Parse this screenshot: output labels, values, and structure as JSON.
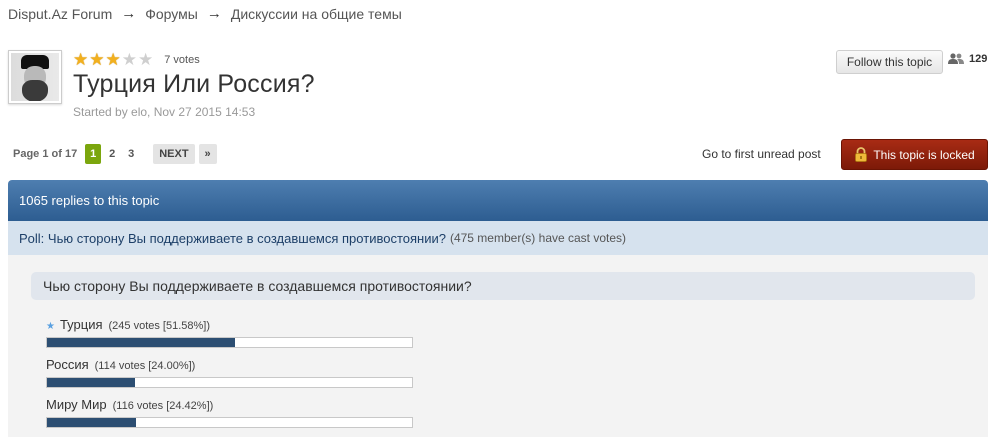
{
  "breadcrumb": {
    "items": [
      "Disput.Az Forum",
      "Форумы",
      "Дискуссии на общие темы"
    ],
    "separator": "→"
  },
  "topic": {
    "title": "Турция Или Россия?",
    "started": "Started by elo, Nov 27 2015 14:53",
    "rating": {
      "stars_on": 3,
      "stars_total": 5,
      "votes_label": "7 votes"
    },
    "follow_label": "Follow this topic",
    "followers_count": "129",
    "avatar_alt": "user avatar"
  },
  "pagination": {
    "label": "Page 1 of 17",
    "pages": [
      "1",
      "2",
      "3"
    ],
    "current": "1",
    "next_label": "NEXT",
    "last_label": "»"
  },
  "actions": {
    "first_unread": "Go to first unread post",
    "locked_label": "This topic is locked"
  },
  "replies_bar": "1065 replies to this topic",
  "poll": {
    "title": "Poll: Чью сторону Вы поддерживаете в создавшемся противостоянии?",
    "members_voted": "(475 member(s) have cast votes)",
    "question": "Чью сторону Вы поддерживаете в создавшемся противостоянии?",
    "choices": [
      {
        "label": "Турция",
        "votes": "(245 votes [51.58%])",
        "percent": 51.58,
        "voted": true
      },
      {
        "label": "Россия",
        "votes": "(114 votes [24.00%])",
        "percent": 24.0,
        "voted": false
      },
      {
        "label": "Миру Мир",
        "votes": "(116 votes [24.42%])",
        "percent": 24.42,
        "voted": false
      }
    ]
  },
  "colors": {
    "accent_green": "#7ba60d",
    "locked_red": "#941f0b",
    "header_blue": "#3d6da0",
    "poll_fill": "#2c4e72"
  }
}
